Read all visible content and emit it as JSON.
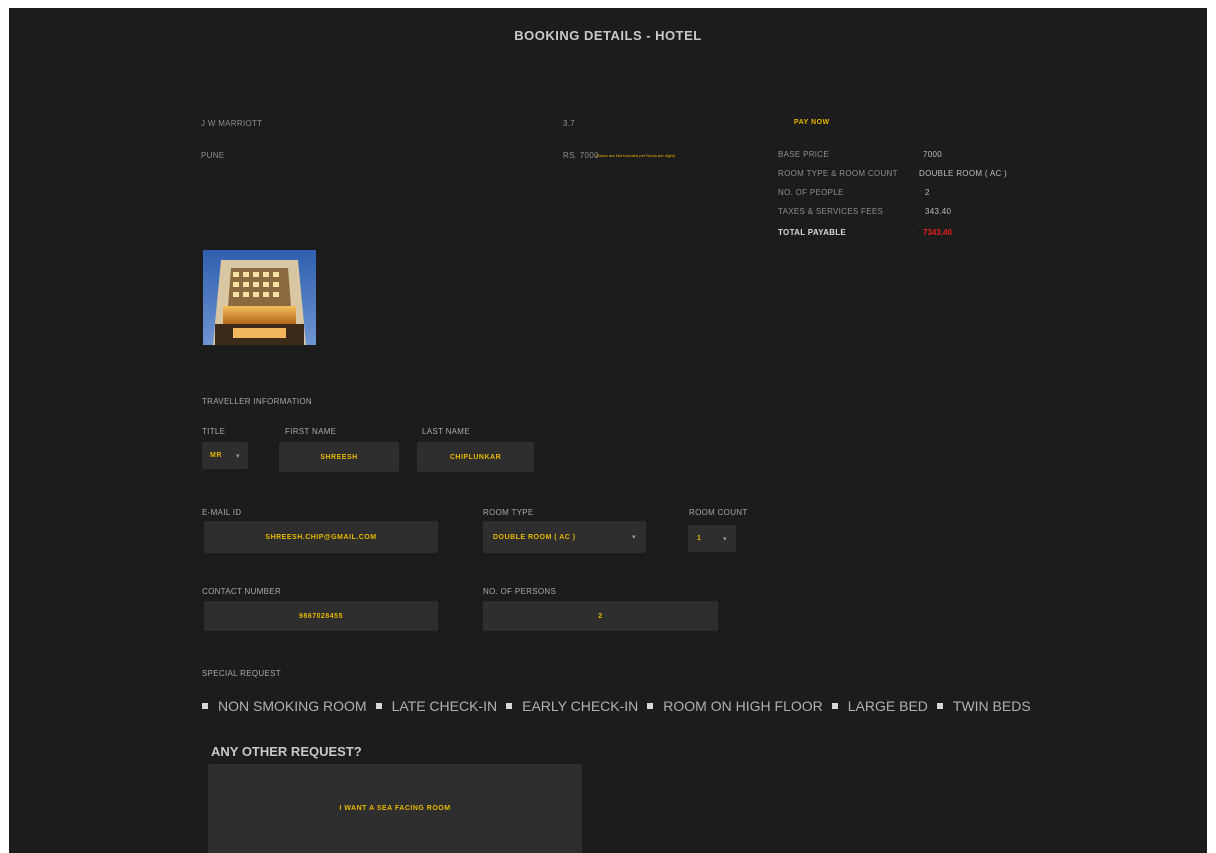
{
  "page": {
    "title": "BOOKING DETAILS - HOTEL"
  },
  "hotel": {
    "name": "J W MARRIOTT",
    "city": "PUNE",
    "rating": "3.7",
    "price": "RS. 7000",
    "price_note": "(Taxes are Not Included per Room per night)"
  },
  "payment": {
    "pay_now_label": "PAY NOW",
    "rows": [
      {
        "label": "BASE PRICE",
        "value": "7000"
      },
      {
        "label": "ROOM TYPE & ROOM COUNT",
        "value": "DOUBLE ROOM ( AC )"
      },
      {
        "label": "NO. OF PEOPLE",
        "value": "2"
      },
      {
        "label": "TAXES & SERVICES FEES",
        "value": "343.40"
      }
    ],
    "total_label": "TOTAL PAYABLE",
    "total_sep": ":",
    "total_value": "7343.40"
  },
  "traveller": {
    "heading": "TRAVELLER INFORMATION",
    "title_label": "TITLE",
    "title_value": "MR",
    "first_name_label": "FIRST NAME",
    "first_name_value": "SHREESH",
    "last_name_label": "LAST NAME",
    "last_name_value": "CHIPLUNKAR",
    "email_label": "E-MAIL ID",
    "email_value": "SHREESH.CHIP@GMAIL.COM",
    "room_type_label": "ROOM TYPE",
    "room_type_value": "DOUBLE ROOM ( AC )",
    "room_count_label": "ROOM COUNT",
    "room_count_value": "1",
    "contact_label": "CONTACT NUMBER",
    "contact_value": "9867028455",
    "persons_label": "NO. OF PERSONS",
    "persons_value": "2"
  },
  "special": {
    "heading": "SPECIAL REQUEST",
    "options": [
      "NON SMOKING ROOM",
      "LATE CHECK-IN",
      "EARLY CHECK-IN",
      "ROOM ON HIGH FLOOR",
      "LARGE BED",
      "TWIN BEDS"
    ],
    "other_heading": "ANY OTHER REQUEST?",
    "other_value": "I WANT A SEA FACING ROOM"
  },
  "icons": {
    "dropdown": "chevron-down-icon",
    "bullet": "checkbox-icon"
  },
  "colors": {
    "accent": "#e6b800",
    "total": "#e61e1e",
    "background": "#1c1c1c",
    "field": "#2e2e2e"
  }
}
